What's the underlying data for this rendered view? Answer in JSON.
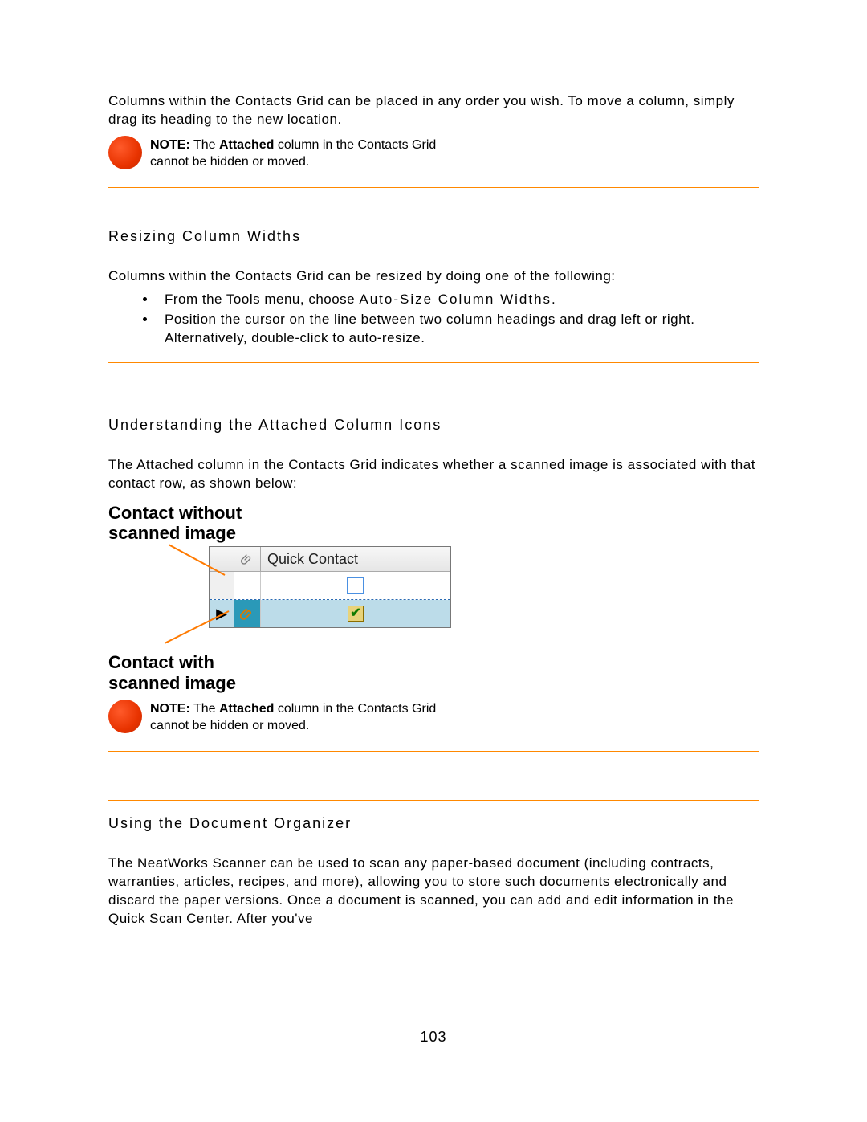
{
  "intro_paragraph": "Columns within the Contacts Grid can be placed in any order you wish. To move a column, simply drag its heading to the new location.",
  "note1": {
    "prefix": "NOTE:",
    "bold_word": "Attached",
    "text_before": " The ",
    "text_after": " column in the Contacts Grid cannot be hidden or moved."
  },
  "section1": {
    "heading": "Resizing Column Widths",
    "intro": "Columns within the Contacts Grid can be resized by doing one of the following:",
    "bullets": [
      {
        "lead": "From the Tools menu, choose ",
        "bold": "Auto-Size Column Widths",
        "tail": "."
      },
      {
        "lead": "Position the cursor on the line between two column headings and drag left or right. Alternatively, double-click to auto-resize.",
        "bold": "",
        "tail": ""
      }
    ]
  },
  "section2": {
    "heading": "Understanding the Attached Column Icons",
    "intro": "The Attached column in the Contacts Grid indicates whether a scanned image is associated with that contact row, as shown below:",
    "illus": {
      "label_top_line1": "Contact without",
      "label_top_line2": "scanned image",
      "header_col": "Quick Contact",
      "label_bottom_line1": "Contact with",
      "label_bottom_line2": "scanned image"
    }
  },
  "note2": {
    "prefix": "NOTE:",
    "bold_word": "Attached",
    "text_before": " The ",
    "text_after": " column in the Contacts Grid cannot be hidden or moved."
  },
  "section3": {
    "heading": "Using the Document Organizer",
    "body": "The NeatWorks Scanner can be used to scan any paper-based document (including contracts, warranties, articles, recipes, and more), allowing you to store such documents electronically and discard the paper versions. Once a document is scanned, you can add and edit information in the Quick Scan Center. After you've"
  },
  "page_number": "103"
}
